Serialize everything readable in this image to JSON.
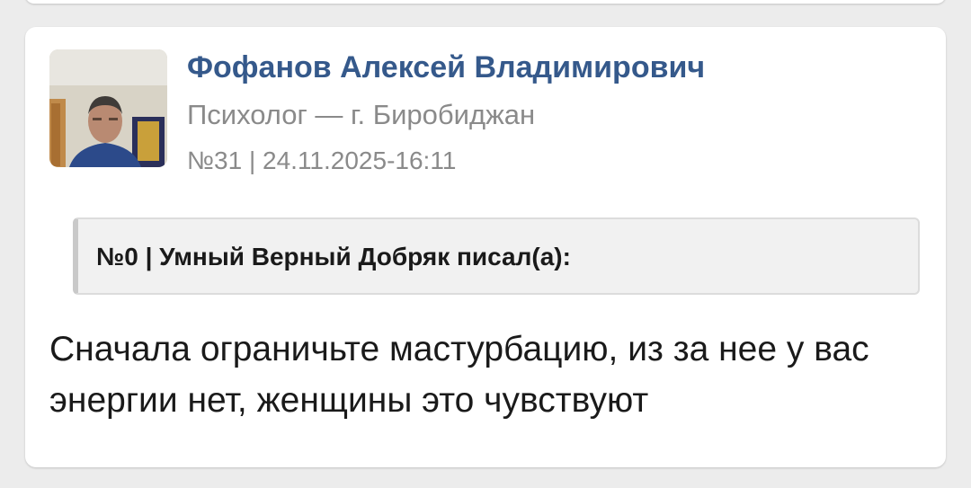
{
  "post": {
    "author_name": "Фофанов Алексей Владимирович",
    "author_role": "Психолог — г. Биробиджан",
    "meta": "№31 | 24.11.2025-16:11",
    "quote_header": "№0 | Умный Верный Добряк писал(а):",
    "body": "Сначала ограничьте мастурбацию, из за нее у вас энергии нет, женщины это чувствуют"
  },
  "colors": {
    "author_link": "#35598b",
    "secondary_text": "#8a8a8a",
    "page_background": "#ececec",
    "card_background": "#ffffff",
    "quote_background": "#f1f1f1"
  }
}
